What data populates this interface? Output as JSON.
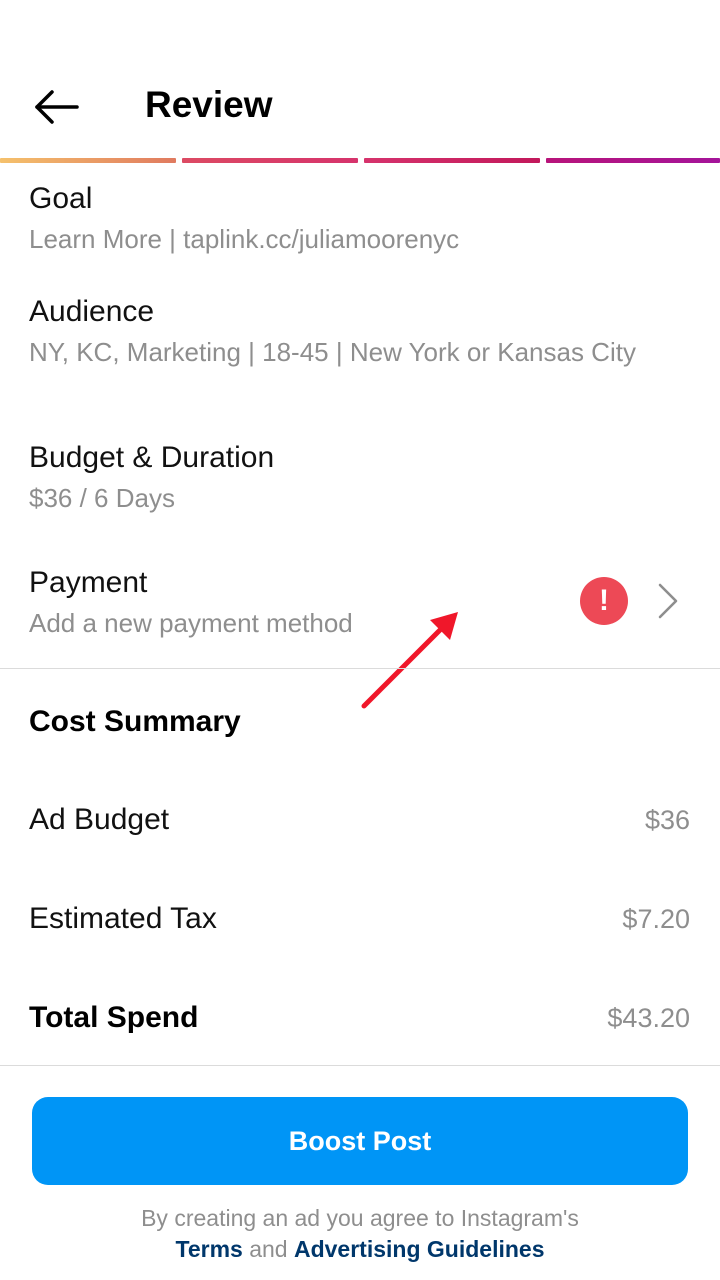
{
  "header": {
    "title": "Review",
    "back_icon": "arrow-left-icon"
  },
  "progress": {
    "segment_count": 4,
    "colors": [
      "#f5c16c",
      "#d6336c",
      "#c2185b",
      "#a4149a"
    ]
  },
  "review": {
    "goal": {
      "title": "Goal",
      "value": "Learn More | taplink.cc/juliamoorenyc"
    },
    "audience": {
      "title": "Audience",
      "value": "NY, KC, Marketing | 18-45 | New York or Kansas City"
    },
    "budget": {
      "title": "Budget & Duration",
      "value": "$36 / 6 Days"
    },
    "payment": {
      "title": "Payment",
      "value": "Add a new payment method",
      "alert_glyph": "!",
      "alert_icon": "exclamation-circle-icon",
      "chevron_icon": "chevron-right-icon"
    }
  },
  "cost_summary": {
    "title": "Cost Summary",
    "ad_budget": {
      "label": "Ad Budget",
      "value": "$36"
    },
    "estimated_tax": {
      "label": "Estimated Tax",
      "value": "$7.20"
    },
    "total_spend": {
      "label": "Total Spend",
      "value": "$43.20"
    }
  },
  "cta": {
    "label": "Boost Post",
    "color": "#0095f6"
  },
  "legal": {
    "prefix": "By creating an ad you agree to Instagram's",
    "terms": "Terms",
    "and": "and",
    "guidelines": "Advertising Guidelines"
  },
  "colors": {
    "alert": "#ed4956",
    "annotation_arrow": "#f0172a",
    "link": "#00376b",
    "muted_text": "#8e8e8e"
  }
}
